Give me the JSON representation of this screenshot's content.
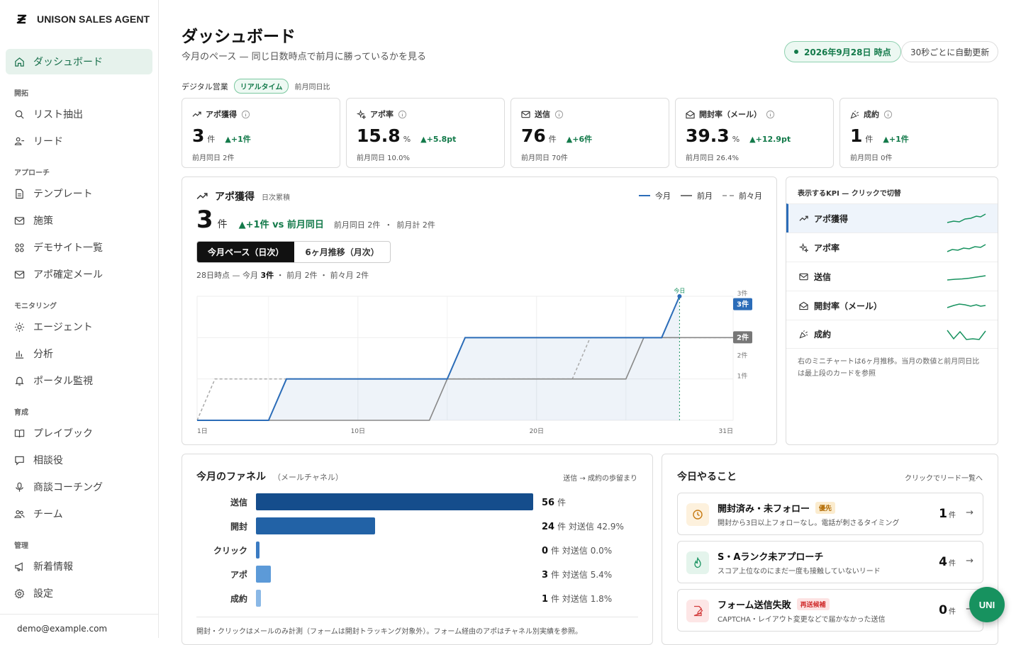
{
  "app": {
    "name": "UNISON SALES AGENT",
    "user_email": "demo@example.com"
  },
  "sidebar": {
    "active": "ダッシュボード",
    "items": [
      {
        "label": "ダッシュボード"
      },
      {
        "section": "開拓"
      },
      {
        "label": "リスト抽出"
      },
      {
        "label": "リード"
      },
      {
        "section": "アプローチ"
      },
      {
        "label": "テンプレート"
      },
      {
        "label": "施策"
      },
      {
        "label": "デモサイト一覧"
      },
      {
        "label": "アポ確定メール"
      },
      {
        "section": "モニタリング"
      },
      {
        "label": "エージェント"
      },
      {
        "label": "分析"
      },
      {
        "label": "ポータル監視"
      },
      {
        "section": "育成"
      },
      {
        "label": "プレイブック"
      },
      {
        "label": "相談役"
      },
      {
        "label": "商談コーチング"
      },
      {
        "label": "チーム"
      },
      {
        "section": "管理"
      },
      {
        "label": "新着情報"
      },
      {
        "label": "設定"
      }
    ]
  },
  "header": {
    "title": "ダッシュボード",
    "subtitle": "今月のペース — 同じ日数時点で前月に勝っているかを見る",
    "date_badge": "2026年9月28日 時点",
    "auto_refresh": "30秒ごとに自動更新"
  },
  "section": {
    "name": "デジタル営業",
    "realtime": "リアルタイム",
    "compare": "前月同日比"
  },
  "kpis": [
    {
      "label": "アポ獲得",
      "value": "3",
      "unit": "件",
      "delta": "▲+1件",
      "prev": "前月同日 2件"
    },
    {
      "label": "アポ率",
      "value": "15.8",
      "unit": "%",
      "delta": "▲+5.8pt",
      "prev": "前月同日 10.0%"
    },
    {
      "label": "送信",
      "value": "76",
      "unit": "件",
      "delta": "▲+6件",
      "prev": "前月同日 70件"
    },
    {
      "label": "開封率（メール）",
      "value": "39.3",
      "unit": "%",
      "delta": "▲+12.9pt",
      "prev": "前月同日 26.4%"
    },
    {
      "label": "成約",
      "value": "1",
      "unit": "件",
      "delta": "▲+1件",
      "prev": "前月同日 0件"
    }
  ],
  "main_chart": {
    "title": "アポ獲得",
    "tag": "日次累積",
    "big_value": "3",
    "big_unit": "件",
    "vs": "▲+1件 vs 前月同日",
    "prev_same_day": "前月同日 2件",
    "prev_total": "前月計 2件",
    "legend": [
      "今月",
      "前月",
      "前々月"
    ],
    "tabs": [
      "今月ペース（日次）",
      "6ヶ月推移（月次）"
    ],
    "caption_prefix": "28日時点 — 今月",
    "caption_value": "3件",
    "caption_rest": "・ 前月 2件 ・ 前々月 2件",
    "today_label": "今日",
    "x_ticks": [
      "1日",
      "10日",
      "20日",
      "31日"
    ],
    "y_ticks": [
      "3件",
      "2件",
      "2件",
      "1件"
    ],
    "badge_current": "3件",
    "badge_prev": "2件"
  },
  "chart_data": {
    "type": "line",
    "title": "アポ獲得",
    "xlabel": "",
    "ylabel": "",
    "xlim": [
      1,
      31
    ],
    "ylim": [
      0,
      3
    ],
    "series": [
      {
        "name": "今月",
        "color": "#2b6cb8",
        "points": [
          [
            1,
            0
          ],
          [
            5,
            0
          ],
          [
            6,
            1
          ],
          [
            15,
            1
          ],
          [
            16,
            2
          ],
          [
            26,
            2
          ],
          [
            27,
            2
          ],
          [
            28,
            3
          ]
        ]
      },
      {
        "name": "前月",
        "color": "#888888",
        "points": [
          [
            1,
            0
          ],
          [
            14,
            0
          ],
          [
            15,
            1
          ],
          [
            25,
            1
          ],
          [
            26,
            2
          ],
          [
            31,
            2
          ]
        ]
      },
      {
        "name": "前々月",
        "color": "#aaaaaa",
        "points": [
          [
            1,
            0
          ],
          [
            2,
            1
          ],
          [
            6,
            1
          ],
          [
            7,
            1
          ],
          [
            14,
            1
          ],
          [
            22,
            1
          ],
          [
            23,
            2
          ],
          [
            31,
            2
          ]
        ]
      }
    ],
    "today_x": 28,
    "grid": true,
    "legend_position": "top-right"
  },
  "kpi_selector": {
    "title": "表示するKPI — クリックで切替",
    "items": [
      "アポ獲得",
      "アポ率",
      "送信",
      "開封率（メール）",
      "成約"
    ],
    "note": "右のミニチャートは6ヶ月推移。当月の数値と前月同日比は最上段のカードを参照"
  },
  "funnel": {
    "title": "今月のファネル",
    "subtitle": "（メールチャネル）",
    "right_note": "送信 → 成約の歩留まり",
    "rows": [
      {
        "label": "送信",
        "value": 56,
        "ratio": "",
        "color": "#154d8c"
      },
      {
        "label": "開封",
        "value": 24,
        "ratio": "対送信 42.9%",
        "color": "#2262a6"
      },
      {
        "label": "クリック",
        "value": 0,
        "ratio": "対送信 0.0%",
        "color": "#3b7bc2"
      },
      {
        "label": "アポ",
        "value": 3,
        "ratio": "対送信 5.4%",
        "color": "#5c9ad8"
      },
      {
        "label": "成約",
        "value": 1,
        "ratio": "対送信 1.8%",
        "color": "#8ab8e6"
      }
    ],
    "unit": "件",
    "footnote": "開封・クリックはメールのみ計測（フォームは開封トラッキング対象外）。フォーム経由のアポはチャネル別実績を参照。"
  },
  "todo": {
    "title": "今日やること",
    "link": "クリックでリード一覧へ",
    "items": [
      {
        "title": "開封済み・未フォロー",
        "tag": "優先",
        "desc": "開封から3日以上フォローなし。電話が刺さるタイミング",
        "count": "1",
        "unit": "件"
      },
      {
        "title": "S・Aランク未アプローチ",
        "tag": "",
        "desc": "スコア上位なのにまだ一度も接触していないリード",
        "count": "4",
        "unit": "件"
      },
      {
        "title": "フォーム送信失敗",
        "tag": "再送候補",
        "desc": "CAPTCHA・レイアウト変更などで届かなかった送信",
        "count": "0",
        "unit": "件"
      }
    ]
  },
  "fab": {
    "label": "UNI"
  }
}
